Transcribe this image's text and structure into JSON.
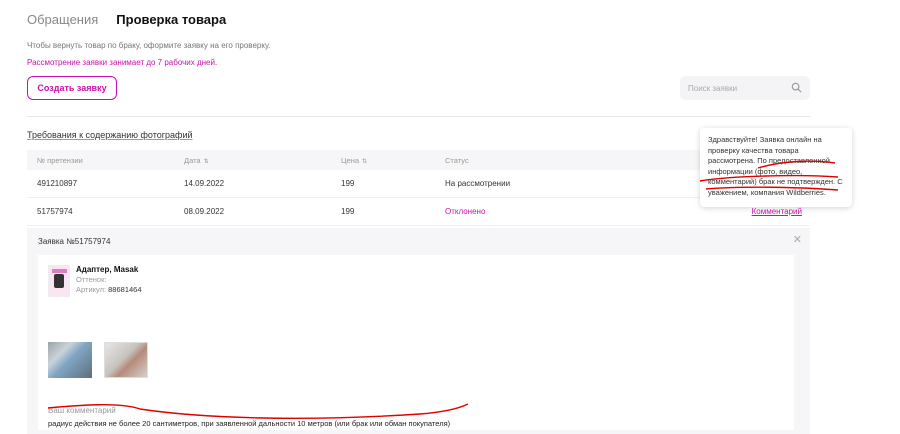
{
  "tabs": [
    {
      "label": "Обращения",
      "active": false
    },
    {
      "label": "Проверка товара",
      "active": true
    }
  ],
  "info": {
    "line1": "Чтобы вернуть товар по браку, оформите заявку на его проверку.",
    "line2": "Рассмотрение заявки занимает до 7 рабочих дней."
  },
  "create_button": "Создать заявку",
  "search": {
    "placeholder": "Поиск заявки",
    "icon": "search-icon"
  },
  "requirements_link": "Требования к содержанию фотографий",
  "table": {
    "headers": [
      "№ претензии",
      "Дата",
      "Цена",
      "Статус"
    ],
    "rows": [
      {
        "id": "491210897",
        "date": "14.09.2022",
        "price": "199",
        "status": "На рассмотрении",
        "comment": ""
      },
      {
        "id": "51757974",
        "date": "08.09.2022",
        "price": "199",
        "status": "Отклонено",
        "comment": "Комментарий"
      }
    ]
  },
  "details": {
    "title": "Заявка №51757974",
    "product": {
      "name": "Адаптер, Masak",
      "shade_label": "Оттенок:",
      "article_label": "Артикул:",
      "article": "88681464"
    },
    "comment_label": "Ваш комментарий",
    "comment_text": "радиус действия не более 20 сантиметров, при заявленной дальности 10 метров (или брак или обман покупателя)"
  },
  "tooltip": {
    "text": "Здравствуйте! Заявка онлайн на проверку качества товара рассмотрена. По предоставленной информации (фото, видео, комментарий) брак не подтвержден. С уважением, компания Wildberries."
  },
  "colors": {
    "accent": "#cb11ab",
    "annotation": "#e00000"
  }
}
